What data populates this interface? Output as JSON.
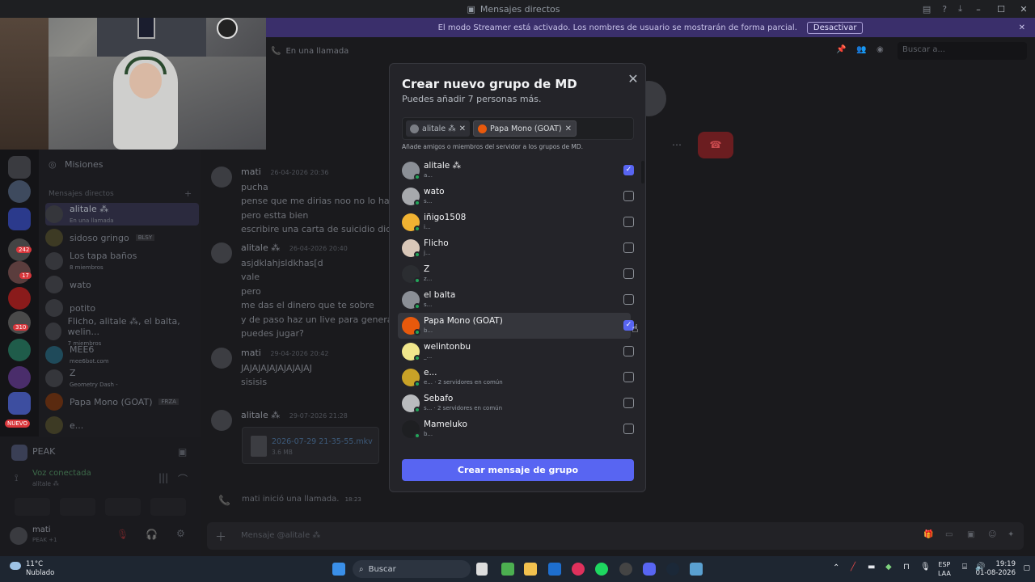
{
  "window": {
    "title": "Mensajes directos",
    "min": "–",
    "max": "☐",
    "close": "✕"
  },
  "streamer_banner": {
    "text": "El modo Streamer está activado. Los nombres de usuario se mostrarán de forma parcial.",
    "button": "Desactivar"
  },
  "chat_header": {
    "call_label": "En una llamada",
    "search_placeholder": "Buscar a..."
  },
  "sidebar": {
    "missions": "Misiones",
    "dm_header": "Mensajes directos",
    "dms": [
      {
        "name": "alitale ⁂",
        "sub": "En una llamada"
      },
      {
        "name": "sidoso gringo",
        "tag": "BLSY"
      },
      {
        "name": "Los tapa baños",
        "sub": "8 miembros"
      },
      {
        "name": "wato"
      },
      {
        "name": "potito"
      },
      {
        "name": "Flicho, alitale ⁂, el balta, welin...",
        "sub": "7 miembros"
      },
      {
        "name": "MEE6",
        "sub": "mee6bot.com"
      },
      {
        "name": "Z",
        "sub": "Geometry Dash -"
      },
      {
        "name": "Papa Mono (GOAT)",
        "tag": "FRZA"
      },
      {
        "name": "e..."
      }
    ],
    "server_badges": [
      "242",
      "17",
      "310"
    ],
    "new_badge": "NUEVO",
    "voice_server": "PEAK",
    "voice_status": "Voz conectada",
    "voice_channel": "alitale ⁂",
    "user_name": "mati",
    "user_status": "PEAK +1"
  },
  "messages": [
    {
      "author": "mati",
      "time": "26-04-2026 20:36",
      "lines": [
        "pucha",
        "pense que me dirias noo no lo hagas eres",
        "pero estta bien",
        "escribire una carta de suicidio diciendo"
      ]
    },
    {
      "author": "alitale ⁂",
      "time": "26-04-2026 20:40",
      "lines": [
        "asjdklahjsldkhas[d",
        "vale",
        "pero",
        "me das el dinero que te sobre",
        "y de paso haz un live para generar mas",
        "puedes jugar?"
      ]
    },
    {
      "author": "mati",
      "time": "29-04-2026 20:42",
      "lines": [
        "JAJAJAJAJAJAJAJAJ",
        "sisisis"
      ]
    },
    {
      "author": "alitale ⁂",
      "time": "29-07-2026 21:28",
      "file": "2026-07-29 21-35-55.mkv",
      "file_size": "3.6 MB"
    }
  ],
  "system_msg": {
    "text": "mati inició una llamada.",
    "time": "18:23"
  },
  "composer": {
    "placeholder": "Mensaje @alitale ⁂"
  },
  "modal": {
    "title": "Crear nuevo grupo de MD",
    "subtitle": "Puedes añadir 7 personas más.",
    "chips": [
      {
        "label": "alitale ⁂"
      },
      {
        "label": "Papa Mono (GOAT)"
      }
    ],
    "helper": "Añade amigos o miembros del servidor a los grupos de MD.",
    "friends": [
      {
        "name": "alitale ⁂",
        "sub": "a...",
        "checked": true,
        "color": "#8b8f96"
      },
      {
        "name": "wato",
        "sub": "s...",
        "checked": false,
        "color": "#a7a9ad"
      },
      {
        "name": "iñigo1508",
        "sub": "i...",
        "checked": false,
        "color": "#f0b232"
      },
      {
        "name": "Flicho",
        "sub": "j...",
        "checked": false,
        "color": "#d9c7b8"
      },
      {
        "name": "Z",
        "sub": "z...",
        "checked": false,
        "color": "#2b2d31"
      },
      {
        "name": "el balta",
        "sub": "s...",
        "checked": false,
        "color": "#8b8f96"
      },
      {
        "name": "Papa Mono (GOAT)",
        "sub": "b...",
        "checked": true,
        "color": "#e8590c"
      },
      {
        "name": "welintonbu",
        "sub": "_...",
        "checked": false,
        "color": "#f0e68c"
      },
      {
        "name": "e...",
        "sub": "e... · 2 servidores en común",
        "checked": false,
        "color": "#c9a227"
      },
      {
        "name": "Sebafo",
        "sub": "s... · 2 servidores en común",
        "checked": false,
        "color": "#b9bbbe"
      },
      {
        "name": "Mameluko",
        "sub": "b...",
        "checked": false,
        "color": "#1e1f22"
      }
    ],
    "create_button": "Crear mensaje de grupo"
  },
  "taskbar": {
    "weather_temp": "11°C",
    "weather_desc": "Nublado",
    "search_placeholder": "Buscar",
    "lang_top": "ESP",
    "lang_bottom": "LAA",
    "time": "19:19",
    "date": "01-08-2026"
  },
  "colors": {
    "accent": "#5865f2",
    "online": "#23a55a",
    "call_red": "#da373c",
    "banner": "#3a2f6b"
  }
}
